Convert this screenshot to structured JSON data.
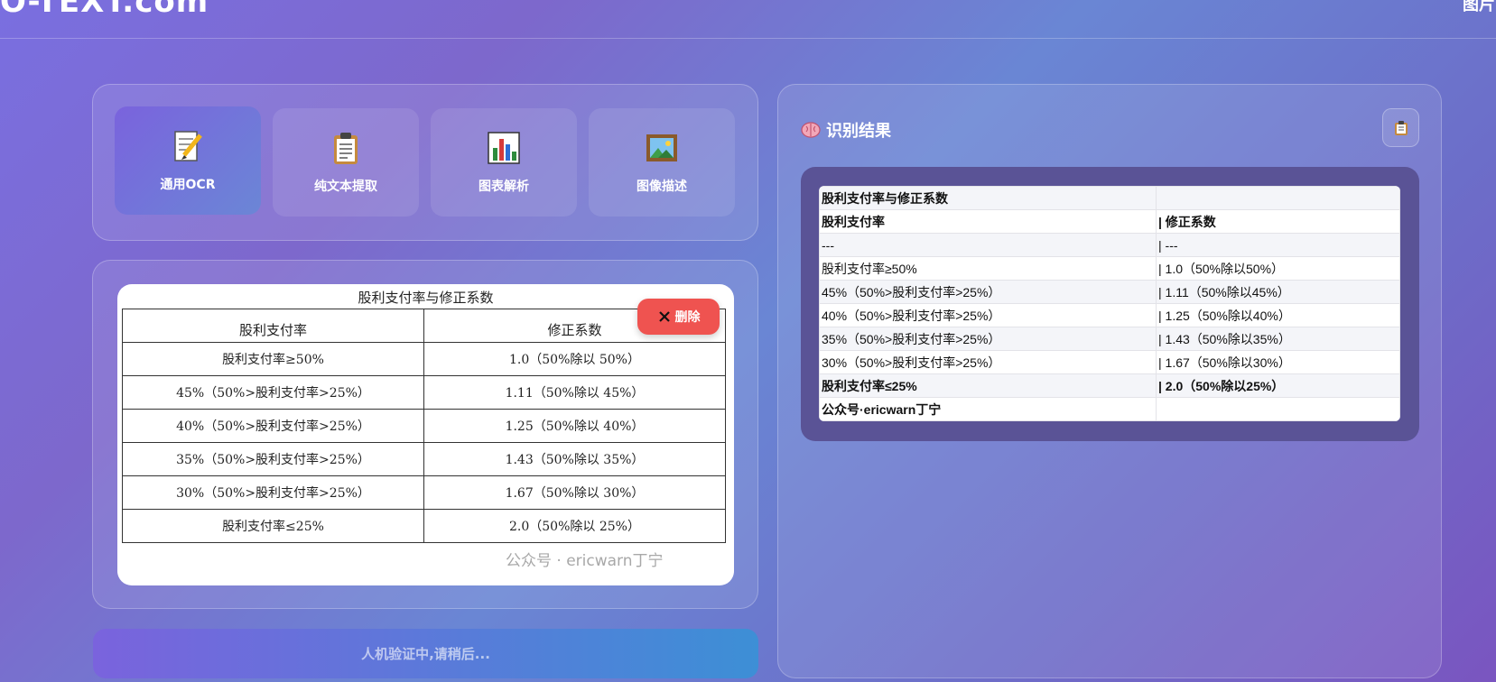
{
  "header": {
    "logo_text": "O-TEXT.com",
    "nav_right": "图片"
  },
  "modes": [
    {
      "label": "通用OCR",
      "icon": "memo-pencil-icon",
      "active": true
    },
    {
      "label": "纯文本提取",
      "icon": "clipboard-icon",
      "active": false
    },
    {
      "label": "图表解析",
      "icon": "bar-chart-icon",
      "active": false
    },
    {
      "label": "图像描述",
      "icon": "framed-picture-icon",
      "active": false
    }
  ],
  "image": {
    "title": "股利支付率与修正系数",
    "header": [
      "股利支付率",
      "修正系数"
    ],
    "rows": [
      [
        "股利支付率≥50%",
        "1.0（50%除以 50%）"
      ],
      [
        "45%（50%>股利支付率>25%）",
        "1.11（50%除以 45%）"
      ],
      [
        "40%（50%>股利支付率>25%）",
        "1.25（50%除以 40%）"
      ],
      [
        "35%（50%>股利支付率>25%）",
        "1.43（50%除以 35%）"
      ],
      [
        "30%（50%>股利支付率>25%）",
        "1.67（50%除以 30%）"
      ],
      [
        "股利支付率≤25%",
        "2.0（50%除以 25%）"
      ]
    ],
    "watermark": "公众号 · ericwarn丁宁",
    "delete_label": "删除"
  },
  "verify": {
    "label": "人机验证中,请稍后..."
  },
  "result": {
    "title": "识别结果",
    "rows": [
      [
        "股利支付率与修正系数",
        ""
      ],
      [
        "股利支付率",
        "| 修正系数"
      ],
      [
        "---",
        "| ---"
      ],
      [
        "股利支付率≥50%",
        "| 1.0（50%除以50%）"
      ],
      [
        "45%（50%>股利支付率>25%）",
        "| 1.11（50%除以45%）"
      ],
      [
        "40%（50%>股利支付率>25%）",
        "| 1.25（50%除以40%）"
      ],
      [
        "35%（50%>股利支付率>25%）",
        "| 1.43（50%除以35%）"
      ],
      [
        "30%（50%>股利支付率>25%）",
        "| 1.67（50%除以30%）"
      ],
      [
        "股利支付率≤25%",
        "| 2.0（50%除以25%）"
      ],
      [
        "公众号·ericwarn丁宁",
        ""
      ]
    ]
  }
}
